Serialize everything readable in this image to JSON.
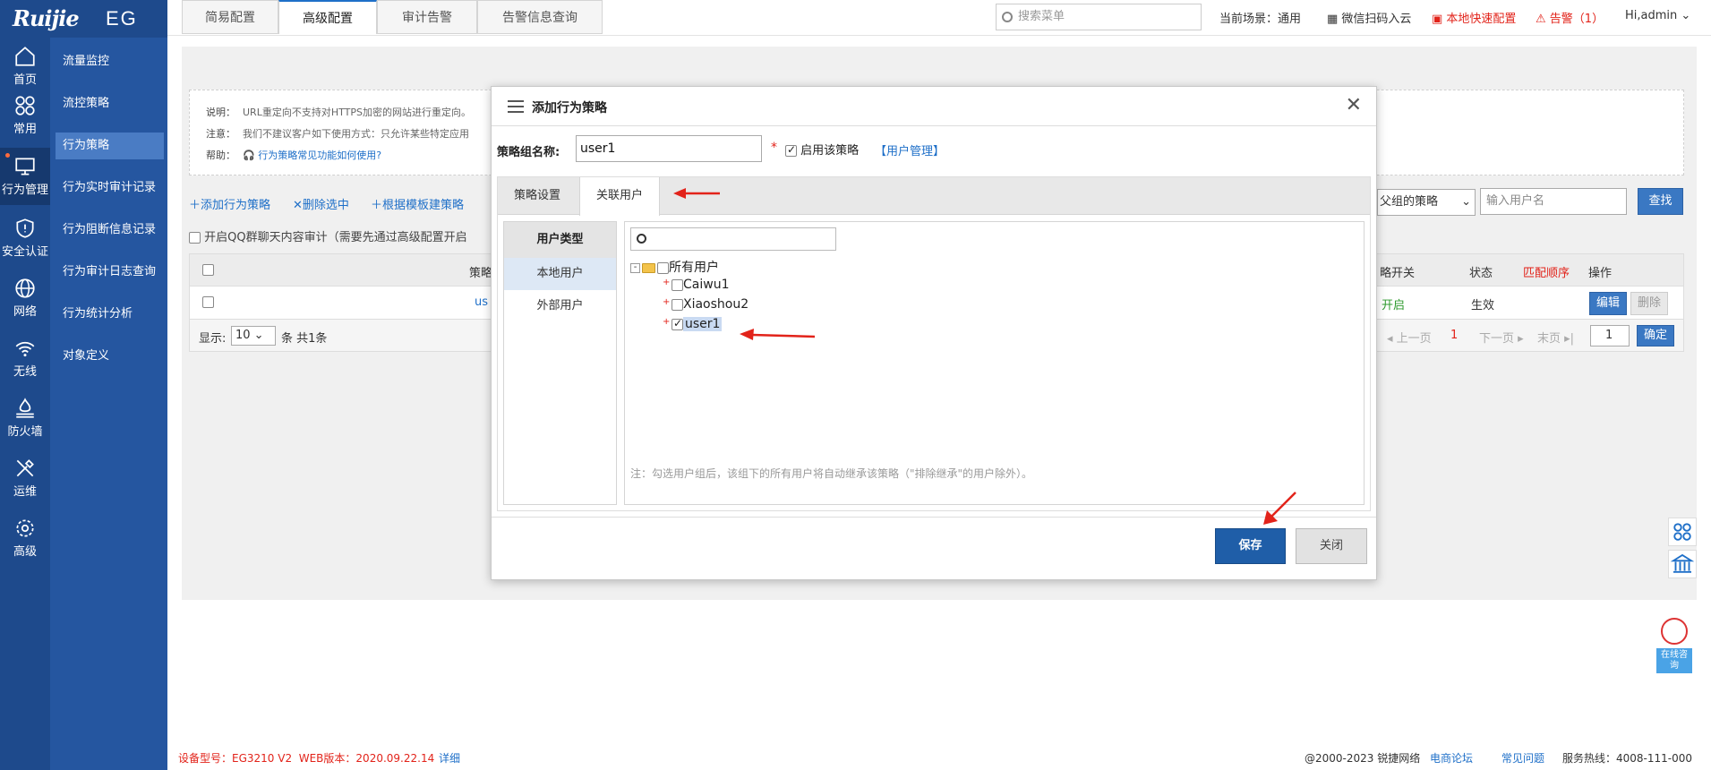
{
  "brand": {
    "logo": "Ruijie",
    "product": "EG"
  },
  "rail": [
    {
      "label": "首页",
      "icon": "home-icon"
    },
    {
      "label": "常用",
      "icon": "grid-icon"
    },
    {
      "label": "行为管理",
      "icon": "monitor-icon"
    },
    {
      "label": "安全认证",
      "icon": "shield-icon"
    },
    {
      "label": "网络",
      "icon": "globe-icon"
    },
    {
      "label": "无线",
      "icon": "wifi-icon"
    },
    {
      "label": "防火墙",
      "icon": "firewall-icon"
    },
    {
      "label": "运维",
      "icon": "tools-icon"
    },
    {
      "label": "高级",
      "icon": "gear-icon"
    }
  ],
  "submenu": [
    "流量监控",
    "流控策略",
    "行为策略",
    "行为实时审计记录",
    "行为阻断信息记录",
    "行为审计日志查询",
    "行为统计分析",
    "对象定义"
  ],
  "topbar": {
    "search_placeholder": "搜索菜单",
    "scene_label": "当前场景：",
    "scene_value": "通用",
    "wechat": "微信扫码入云",
    "quick_config": "本地快速配置",
    "alarm": "告警（1）",
    "user": "Hi,admin"
  },
  "tabs": [
    "简易配置",
    "高级配置",
    "审计告警",
    "告警信息查询"
  ],
  "notes": {
    "l1_label": "说明：",
    "l1_text": "URL重定向不支持对HTTPS加密的网站进行重定向。",
    "l2_label": "注意：",
    "l2_text": "我们不建议客户如下使用方式：只允许某些特定应用",
    "l3_label": "帮助：",
    "l3_text": "行为策略常见功能如何使用?"
  },
  "toolbar": {
    "add": "添加行为策略",
    "del": "删除选中",
    "tpl": "根据模板建策略",
    "qq": "开启QQ群聊天内容审计（需要先通过高级配置开启",
    "filter_select": "父组的策略",
    "filter_placeholder": "输入用户名",
    "search_btn": "查找"
  },
  "table": {
    "headers": {
      "name": "策略",
      "switch": "略开关",
      "status": "状态",
      "order": "匹配顺序",
      "ops": "操作"
    },
    "row": {
      "name": "us",
      "switch": "开启",
      "status": "生效",
      "edit": "编辑",
      "delete": "删除"
    },
    "footer": {
      "show": "显示:",
      "page_size": "10",
      "count": "条 共1条",
      "prev": "上一页",
      "page": "1",
      "next": "下一页",
      "last": "末页",
      "goto": "1",
      "confirm": "确定"
    }
  },
  "modal": {
    "title": "添加行为策略",
    "group_label": "策略组名称:",
    "group_value": "user1",
    "required": "*",
    "enable_label": "启用该策略",
    "user_mgmt": "【用户管理】",
    "inner_tabs": [
      "策略设置",
      "关联用户"
    ],
    "user_type_head": "用户类型",
    "user_types": [
      "本地用户",
      "外部用户"
    ],
    "tree": {
      "root": "所有用户",
      "children": [
        {
          "name": "Caiwu1",
          "checked": false
        },
        {
          "name": "Xiaoshou2",
          "checked": false
        },
        {
          "name": "user1",
          "checked": true
        }
      ]
    },
    "note": "注：勾选用户组后，该组下的所有用户将自动继承该策略（\"排除继承\"的用户除外）。",
    "save": "保存",
    "close": "关闭"
  },
  "footer": {
    "model_label": "设备型号：",
    "model": "EG3210 V2",
    "web_label": "WEB版本：",
    "web": "2020.09.22.14",
    "detail": "详细",
    "copyright": "@2000-2023 锐捷网络",
    "forum": "电商论坛",
    "faq": "常见问题",
    "hotline": "服务热线：4008-111-000"
  },
  "float": {
    "consult": "在线咨询"
  },
  "colors": {
    "rail": "#1e4a8c",
    "submenu": "#2556a0",
    "primary": "#1f5ea8",
    "alert": "#e2231a"
  }
}
